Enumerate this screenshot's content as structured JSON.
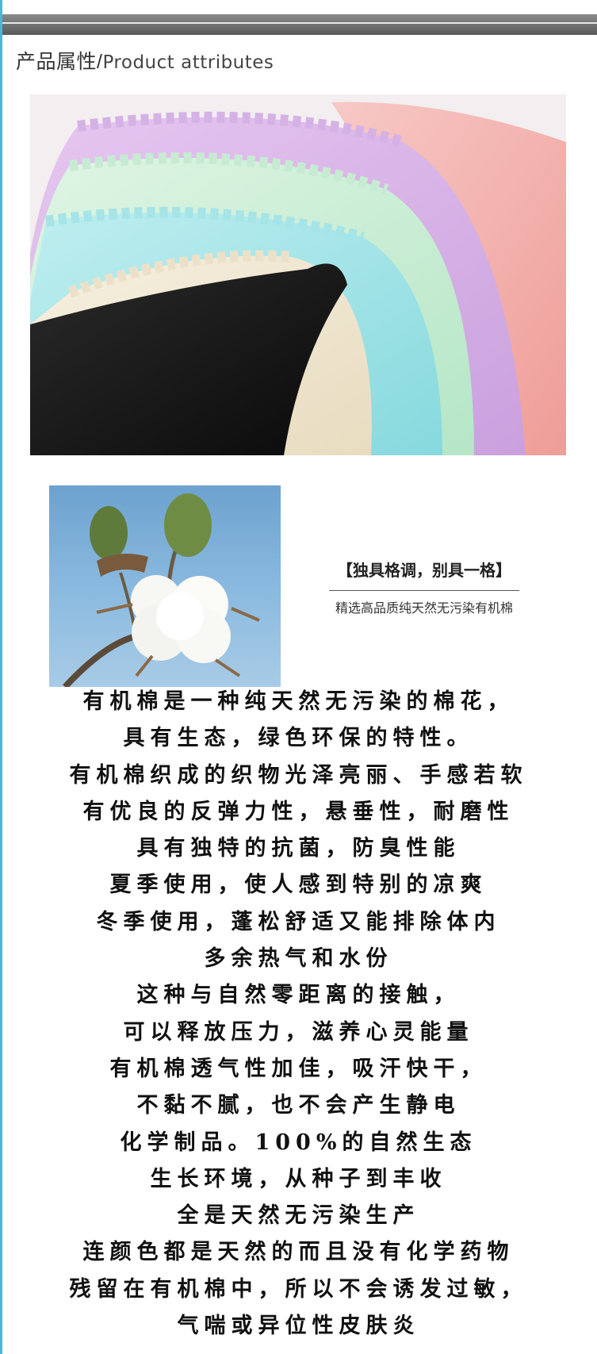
{
  "header": {
    "title_cn": "产品属性",
    "separator": "/",
    "title_en": "Product attributes"
  },
  "images": {
    "fabric": "colorful-cotton-underwear-photo",
    "cotton": "cotton-boll-photo"
  },
  "caption": {
    "title": "【独具格调，别具一格】",
    "subtitle": "精选高品质纯天然无污染有机棉"
  },
  "body_lines": [
    "有机棉是一种纯天然无污染的棉花，",
    "具有生态，绿色环保的特性。",
    "有机棉织成的织物光泽亮丽、手感若软",
    "有优良的反弹力性，悬垂性，耐磨性",
    "具有独特的抗菌，防臭性能",
    "夏季使用，使人感到特别的凉爽",
    "冬季使用，蓬松舒适又能排除体内",
    "多余热气和水份",
    "这种与自然零距离的接触，",
    "可以释放压力，滋养心灵能量",
    "有机棉透气性加佳，吸汗快干，",
    "不黏不腻，也不会产生静电",
    "化学制品。100%的自然生态",
    "生长环境，从种子到丰收",
    "全是天然无污染生产",
    "连颜色都是天然的而且没有化学药物",
    "残留在有机棉中，所以不会诱发过敏，",
    "气喘或异位性皮肤炎"
  ],
  "colors": {
    "accent_edge": "#49b7d6",
    "header_bar": "#6e6e6e",
    "text": "#111111"
  }
}
